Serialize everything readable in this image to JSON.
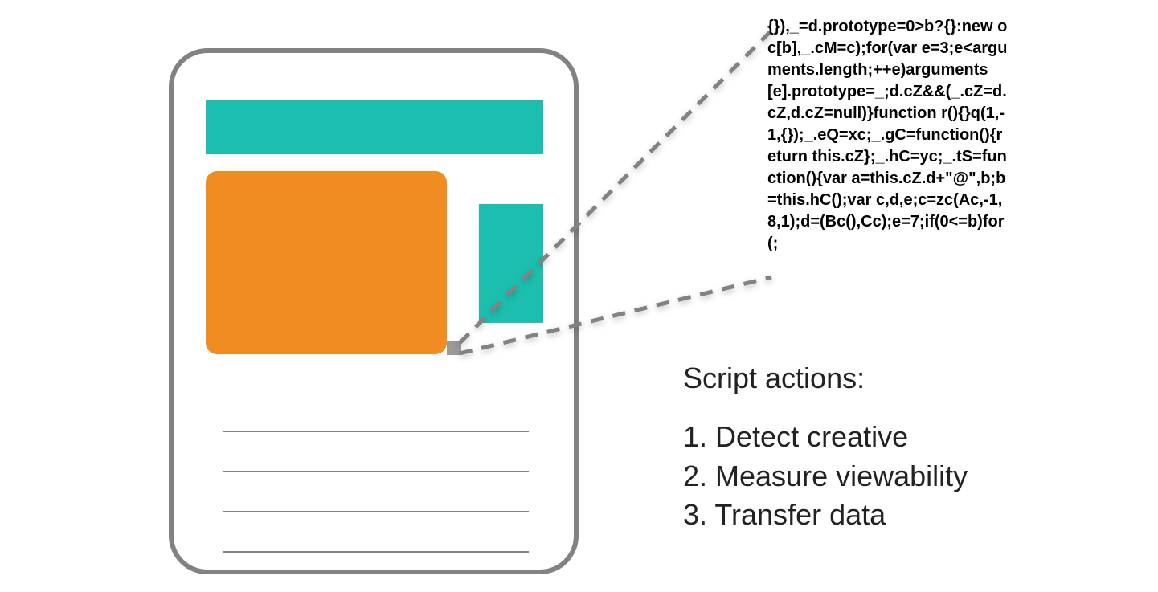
{
  "code_snippet": "{}),_=d.prototype=0>b?{}:new oc[b],_.cM=c);for(var e=3;e<arguments.length;++e)arguments[e].prototype=_;d.cZ&&(_.cZ=d.cZ,d.cZ=null)}function r(){}q(1,-1,{});_.eQ=xc;_.gC=function(){return this.cZ};_.hC=yc;_.tS=function(){var a=this.cZ.d+\"@\",b;b=this.hC();var c,d,e;c=zc(Ac,-1,8,1);d=(Bc(),Cc);e=7;if(0<=b)for(;",
  "script_actions": {
    "heading": "Script actions:",
    "items": [
      "1. Detect creative",
      "2. Measure viewability",
      "3. Transfer data"
    ]
  }
}
